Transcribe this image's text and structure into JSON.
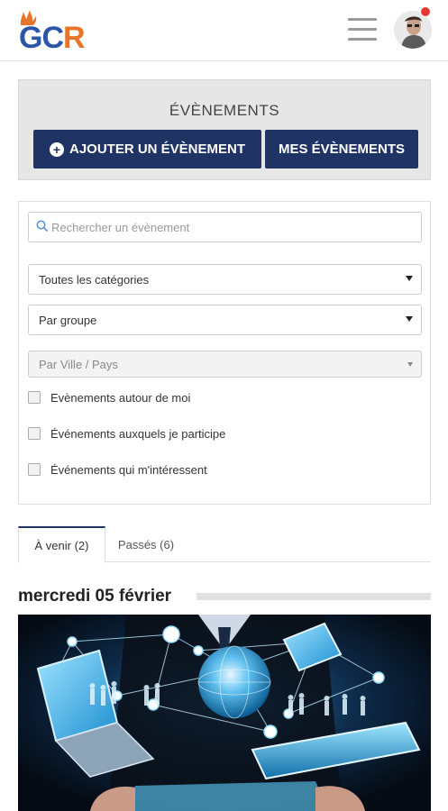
{
  "header": {
    "logo_text": "GCR",
    "menu_icon": "hamburger-icon",
    "avatar_icon": "user-avatar",
    "notification_color": "#e53935"
  },
  "events": {
    "title": "ÉVÈNEMENTS",
    "add_button": "AJOUTER UN ÉVÈNEMENT",
    "mine_button": "MES ÉVÈNEMENTS",
    "accent_color": "#1f3364"
  },
  "filters": {
    "search_placeholder": "Rechercher un évènement",
    "category_select": "Toutes les catégories",
    "group_select": "Par groupe",
    "city_select": "Par Ville / Pays",
    "checkboxes": [
      "Evènements autour de moi",
      "Événements auxquels je participe",
      "Événements qui m'intéressent"
    ]
  },
  "tabs": [
    {
      "label": "À venir (2)",
      "active": true
    },
    {
      "label": "Passés (6)",
      "active": false
    }
  ],
  "event_list": {
    "date_heading": "mercredi 05 février"
  }
}
